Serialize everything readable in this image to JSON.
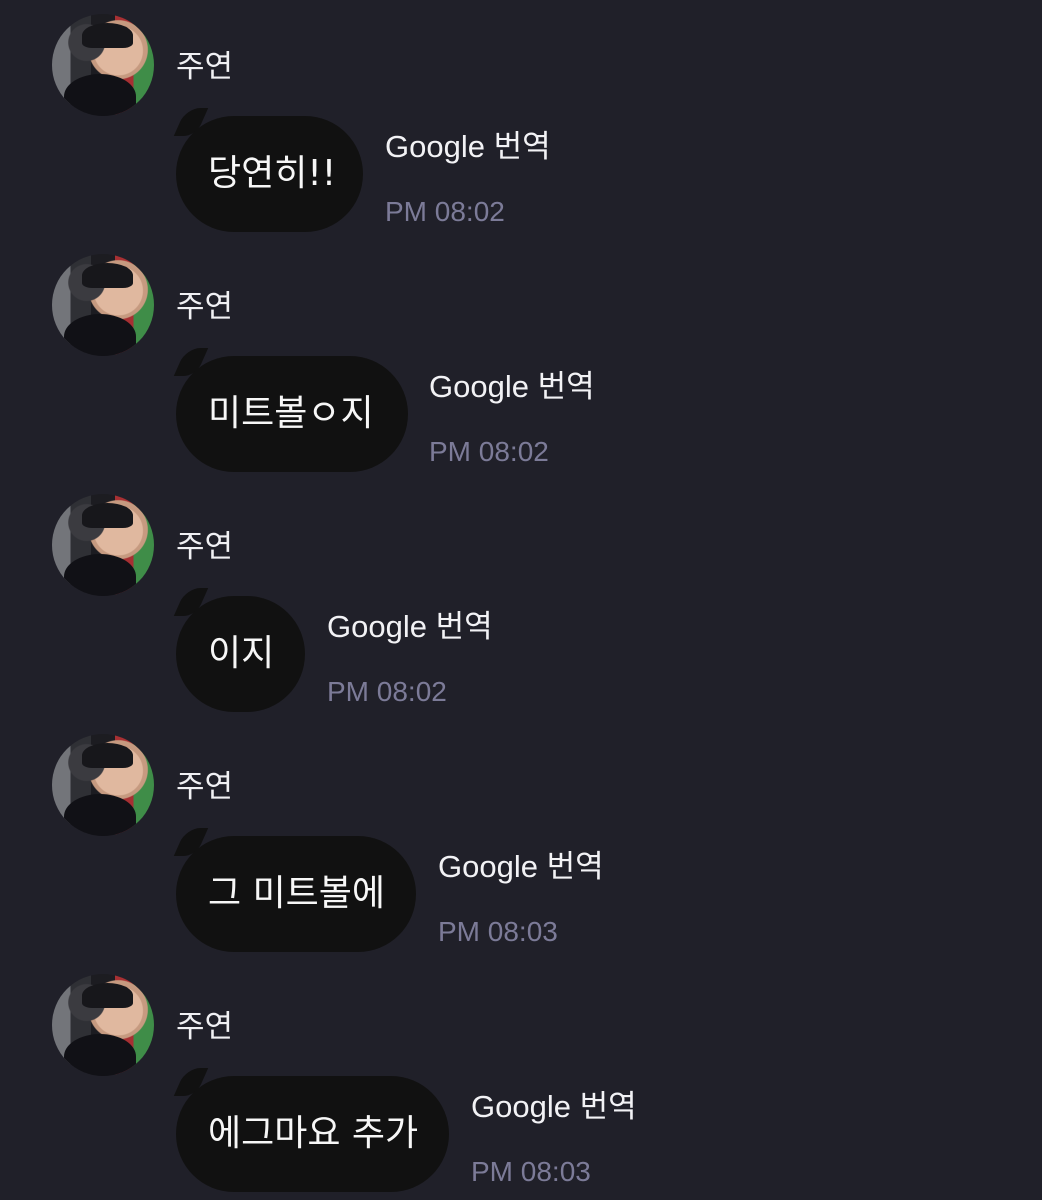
{
  "chat": {
    "messages": [
      {
        "avatar_icon": "profile-photo-avatar",
        "sender": "주연",
        "text": "당연히!!",
        "translate_label": "Google 번역",
        "time": "PM 08:02"
      },
      {
        "avatar_icon": "profile-photo-avatar",
        "sender": "주연",
        "text": "미트볼ㅇ지",
        "translate_label": "Google 번역",
        "time": "PM 08:02"
      },
      {
        "avatar_icon": "profile-photo-avatar",
        "sender": "주연",
        "text": "이지",
        "translate_label": "Google 번역",
        "time": "PM 08:02"
      },
      {
        "avatar_icon": "profile-photo-avatar",
        "sender": "주연",
        "text": "그 미트볼에",
        "translate_label": "Google 번역",
        "time": "PM 08:03"
      },
      {
        "avatar_icon": "profile-photo-avatar",
        "sender": "주연",
        "text": "에그마요 추가",
        "translate_label": "Google 번역",
        "time": "PM 08:03"
      }
    ]
  },
  "colors": {
    "background": "#202029",
    "bubble": "#111111",
    "primary_text": "#f1f1f4",
    "timestamp": "#7c7b98"
  }
}
